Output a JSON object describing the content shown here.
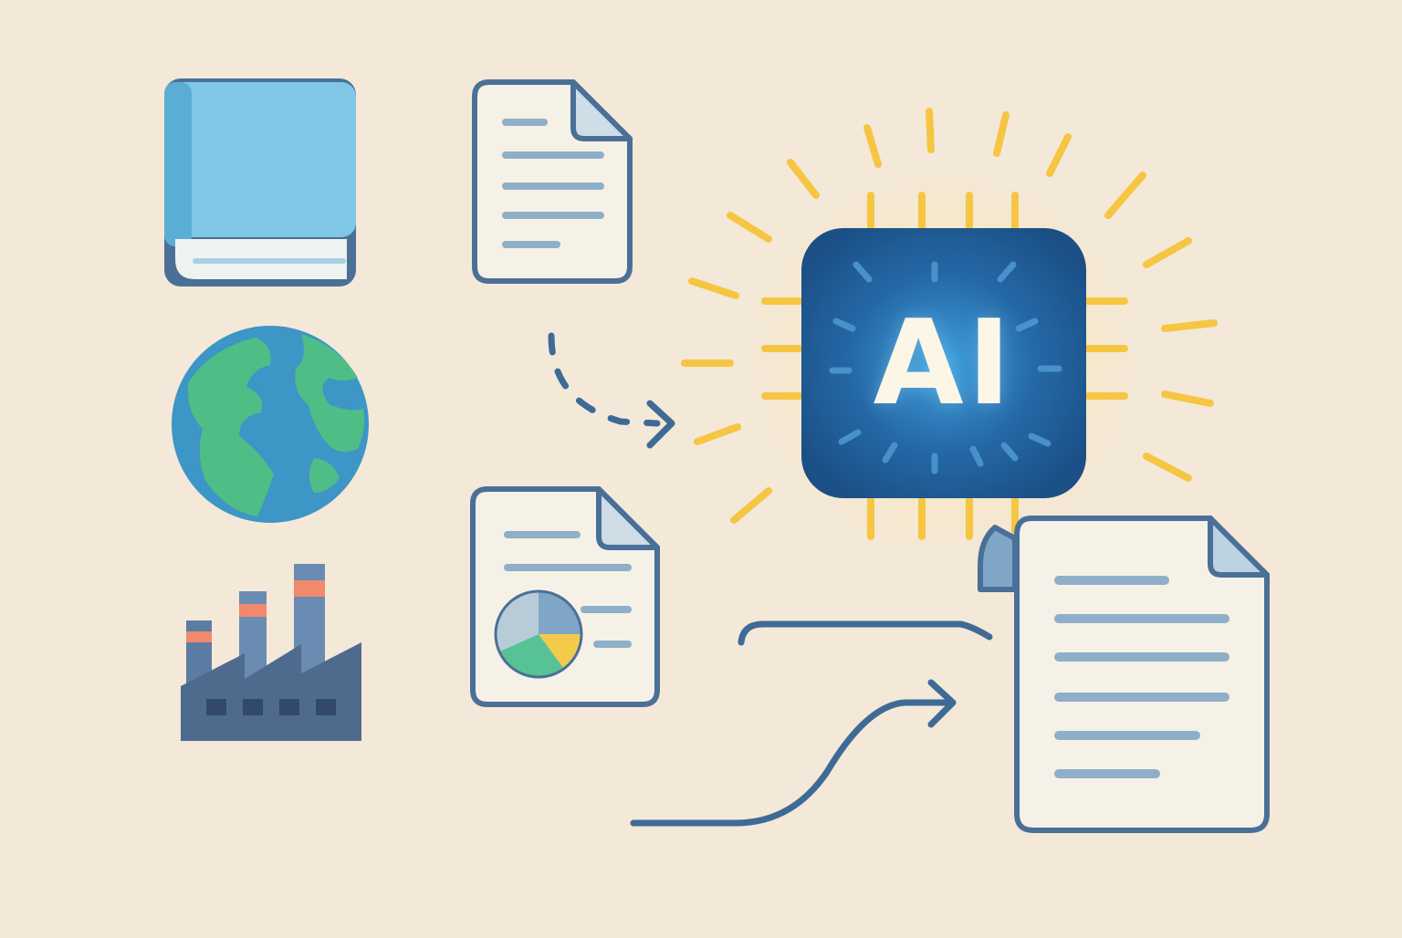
{
  "palette": {
    "background": "#f4e8d8",
    "outline": "#4a7098",
    "paper": "#f6f1e6",
    "text_line": "#8eafc8",
    "book_blue": "#6ab6dc",
    "globe_ocean": "#3d96c6",
    "globe_land": "#4fbe86",
    "factory": "#4e6b8e",
    "factory_stripe": "#f08a6a",
    "ai_chip": "#1f5d96",
    "glow": "#f6c542",
    "pie_yellow": "#f2cb4a",
    "pie_green": "#57c394"
  },
  "sources": [
    "book-icon",
    "globe-icon",
    "factory-icon",
    "document-icon",
    "chart-report-icon"
  ],
  "processor": {
    "label": "AI",
    "icon": "ai-chip-icon"
  },
  "output": {
    "icon": "output-document-icon"
  },
  "connectors": [
    "dashed-arrow",
    "curved-arrow",
    "flow-line"
  ]
}
